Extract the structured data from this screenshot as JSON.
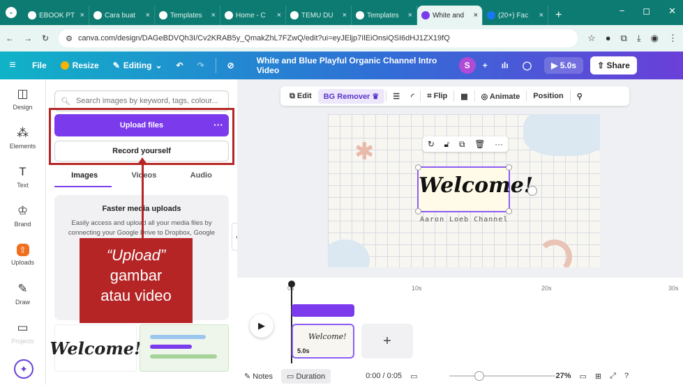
{
  "browser": {
    "tabs": [
      {
        "label": "EBOOK PT"
      },
      {
        "label": "Cara buat"
      },
      {
        "label": "Templates"
      },
      {
        "label": "Home - C"
      },
      {
        "label": "TEMU DU"
      },
      {
        "label": "Templates"
      },
      {
        "label": "White and"
      },
      {
        "label": "(20+) Fac"
      }
    ],
    "active_tab_index": 6,
    "url": "canva.com/design/DAGeBDVQh3I/Cv2KRAB5y_QmakZhL7FZwQ/edit?ui=eyJEljp7IlEiOnsiQSI6dHJ1ZX19fQ"
  },
  "topbar": {
    "file": "File",
    "resize": "Resize",
    "editing": "Editing",
    "doc_title": "White and Blue Playful Organic Channel Intro Video",
    "avatar_letter": "S",
    "play_time": "5.0s",
    "share": "Share"
  },
  "rail": {
    "items": [
      {
        "label": "Design",
        "icon": "design-icon"
      },
      {
        "label": "Elements",
        "icon": "elements-icon"
      },
      {
        "label": "Text",
        "icon": "text-icon"
      },
      {
        "label": "Brand",
        "icon": "brand-icon"
      },
      {
        "label": "Uploads",
        "icon": "upload-icon"
      },
      {
        "label": "Draw",
        "icon": "draw-icon"
      },
      {
        "label": "Projects",
        "icon": "folder-icon"
      }
    ],
    "active": "Uploads"
  },
  "panel": {
    "search_placeholder": "Search images by keyword, tags, colour...",
    "upload_label": "Upload files",
    "record_label": "Record yourself",
    "tabs": [
      "Images",
      "Videos",
      "Audio"
    ],
    "info_title": "Faster media uploads",
    "info_text": "Easily access and upload all your media files by connecting your Google Drive to Dropbox, Google"
  },
  "callout": {
    "line1": "“Upload”",
    "line2": "gambar",
    "line3": "atau video"
  },
  "context_toolbar": {
    "edit": "Edit",
    "bg_remover": "BG Remover",
    "flip": "Flip",
    "animate": "Animate",
    "position": "Position"
  },
  "canvas": {
    "title": "Welcome!",
    "subtitle": "Aaron Loeb Channel"
  },
  "timeline": {
    "ticks": [
      "0s",
      "10s",
      "20s",
      "30s"
    ],
    "clip_duration": "5.0s",
    "notes": "Notes",
    "duration": "Duration",
    "timecode": "0:00 / 0:05",
    "zoom": "27%"
  },
  "colors": {
    "accent": "#7c3aed",
    "highlight": "#b52525",
    "browser": "#0e7b72"
  }
}
